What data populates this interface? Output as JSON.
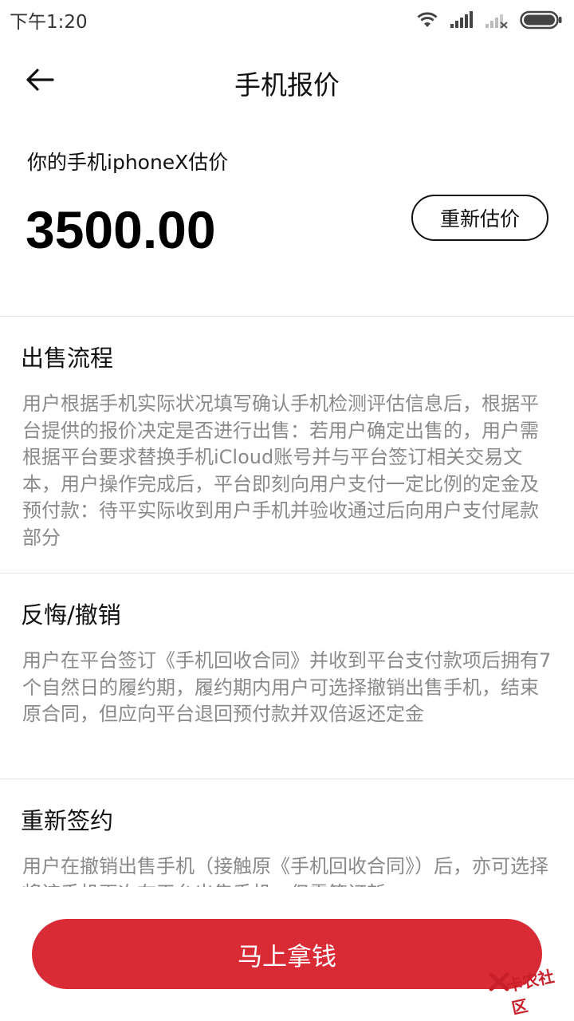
{
  "status_bar": {
    "time": "下午1:20"
  },
  "header": {
    "title": "手机报价"
  },
  "estimate": {
    "label": "你的手机iphoneX估价",
    "price": "3500.00",
    "reestimate_label": "重新估价"
  },
  "sections": [
    {
      "title": "出售流程",
      "body": "用户根据手机实际状况填写确认手机检测评估信息后，根据平台提供的报价决定是否进行出售：若用户确定出售的，用户需根据平台要求替换手机iCloud账号并与平台签订相关交易文本，用户操作完成后，平台即刻向用户支付一定比例的定金及预付款：待平实际收到用户手机并验收通过后向用户支付尾款部分"
    },
    {
      "title": "反悔/撤销",
      "body": "用户在平台签订《手机回收合同》并收到平台支付款项后拥有7个自然日的履约期，履约期内用户可选择撤销出售手机，结束原合同，但应向平台退回预付款并双倍返还定金"
    },
    {
      "title": "重新签约",
      "body": "用户在撤销出售手机（接触原《手机回收合同》）后，亦可选择将该手机再次在平台出售手机，但需签订新"
    }
  ],
  "cta": {
    "label": "马上拿钱"
  },
  "watermark": {
    "text": "卡农社区"
  },
  "colors": {
    "accent": "#d92b36",
    "body_text": "#8a8a8a",
    "divider": "#e2e2e2"
  }
}
